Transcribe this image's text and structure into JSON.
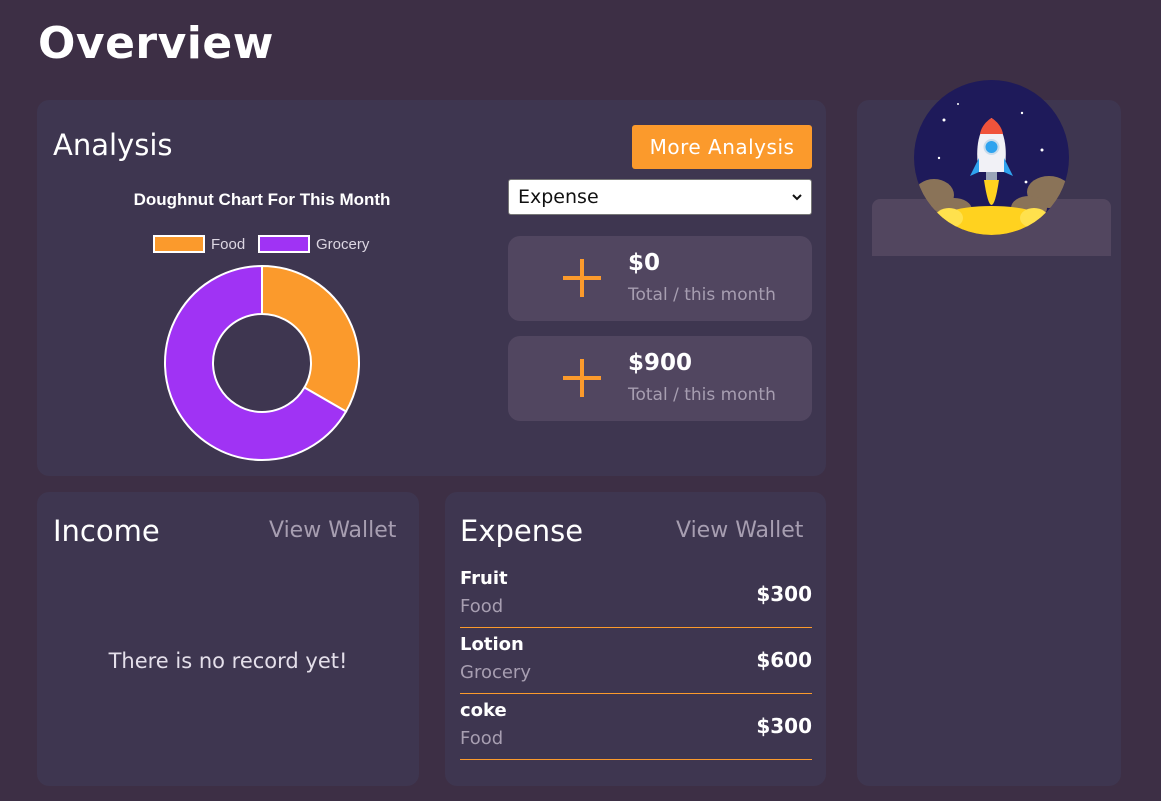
{
  "page": {
    "title": "Overview"
  },
  "analysis": {
    "title": "Analysis",
    "more_button": "More Analysis",
    "select": {
      "value": "Expense"
    },
    "stats": [
      {
        "amount": "$0",
        "label": "Total / this month"
      },
      {
        "amount": "$900",
        "label": "Total / this month"
      }
    ]
  },
  "chart_data": {
    "type": "doughnut",
    "title": "Doughnut Chart For This Month",
    "categories": [
      "Food",
      "Grocery"
    ],
    "values": [
      300,
      600
    ],
    "colors": [
      "#fb9a2c",
      "#a033f4"
    ],
    "legend": "top"
  },
  "income": {
    "title": "Income",
    "view_wallet": "View Wallet",
    "empty": "There is no record yet!"
  },
  "expense": {
    "title": "Expense",
    "view_wallet": "View Wallet",
    "items": [
      {
        "name": "Fruit",
        "category": "Food",
        "amount": "$300"
      },
      {
        "name": "Lotion",
        "category": "Grocery",
        "amount": "$600"
      },
      {
        "name": "coke",
        "category": "Food",
        "amount": "$300"
      }
    ]
  },
  "colors": {
    "accent": "#fb9a2c",
    "background": "#3d2f45",
    "card": "#3e3650"
  },
  "icons": {
    "plus": "plus-icon",
    "avatar": "rocket-avatar",
    "select": "chevron-down-icon"
  }
}
